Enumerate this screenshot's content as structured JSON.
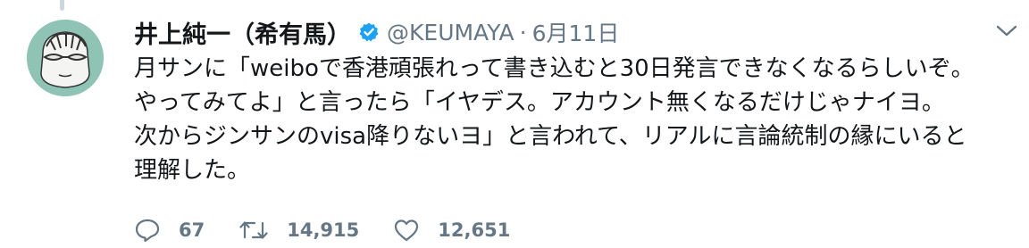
{
  "author": {
    "display_name": "井上純一（希有馬）",
    "handle": "@KEUMAYA",
    "separator": "·",
    "date": "6月11日"
  },
  "body": {
    "lines": [
      "月サンに「weiboで香港頑張れって書き込むと30日発言できなくなるらしいぞ。",
      "やってみてよ」と言ったら「イヤデス。アカウント無くなるだけじゃナイヨ。",
      "次からジンサンのvisa降りないヨ」と言われて、リアルに言論統制の縁にいると",
      "理解した。"
    ]
  },
  "actions": {
    "replies": "67",
    "retweets": "14,915",
    "likes": "12,651"
  },
  "icons": {
    "avatar": "avatar-image",
    "verified": "verified-badge-icon",
    "caret": "chevron-down-icon",
    "reply": "reply-icon",
    "retweet": "retweet-icon",
    "like": "heart-icon"
  },
  "colors": {
    "verified": "#1da1f2",
    "secondary_text": "#657786",
    "primary_text": "#14171a",
    "avatar_bg": "#8fc4b5"
  }
}
